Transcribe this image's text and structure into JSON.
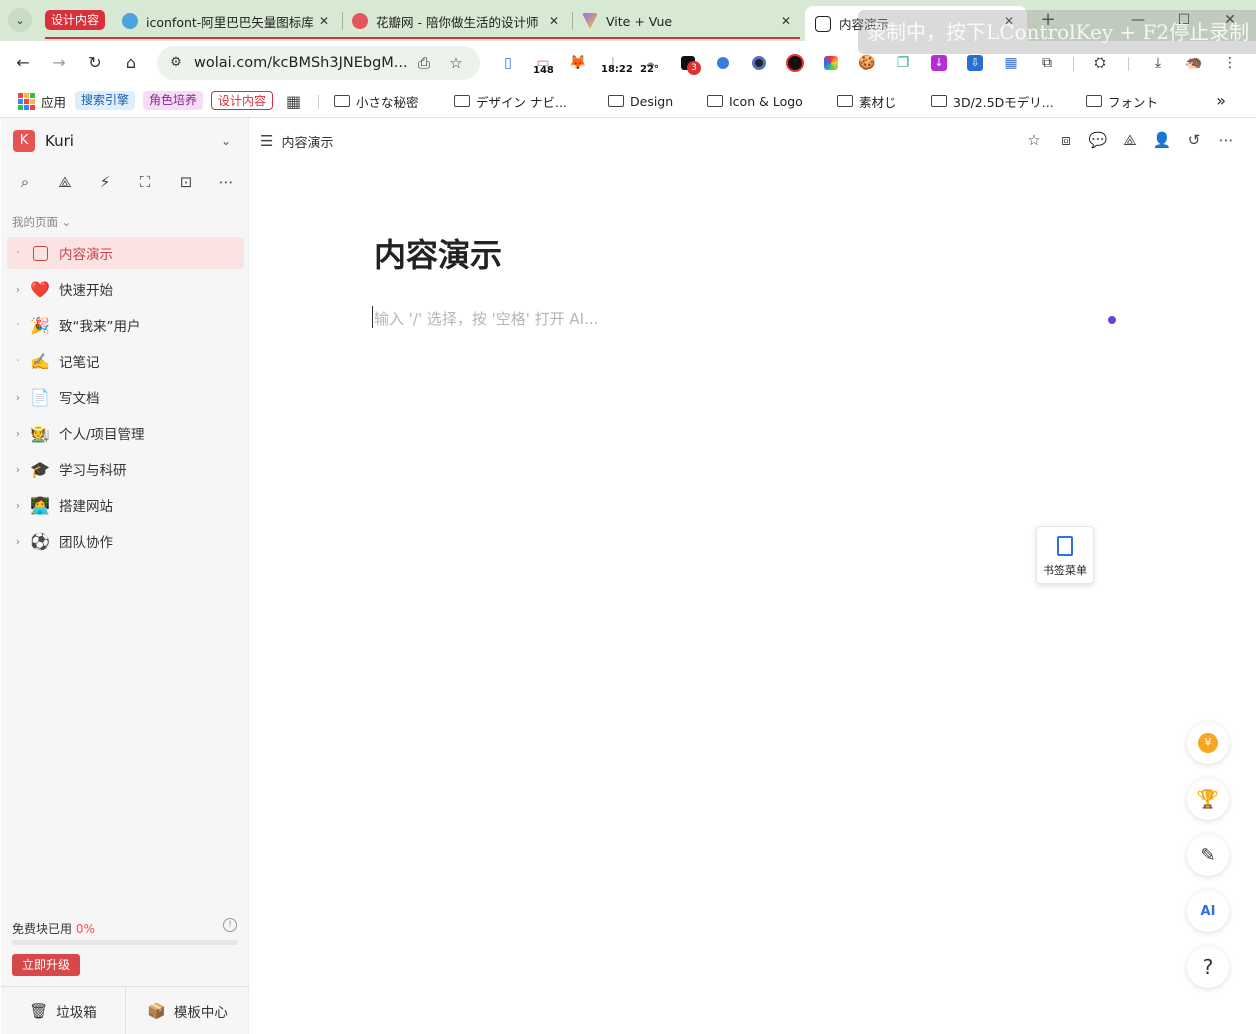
{
  "browser": {
    "tab_group_label": "设计内容",
    "tabs": [
      {
        "title": "iconfont-阿里巴巴矢量图标库",
        "close": "✕"
      },
      {
        "title": "花瓣网 - 陪你做生活的设计师",
        "close": "✕"
      },
      {
        "title": "Vite + Vue",
        "close": "✕"
      },
      {
        "title": "内容演示",
        "close": "✕"
      }
    ],
    "new_tab": "+",
    "recording_overlay": "录制中，按下LControlKey + F2停止录制",
    "url": "wolai.com/kcBMSh3JNEbgM...",
    "extension_badges": {
      "calendar": "148",
      "time": "18:22",
      "weather": "22°",
      "notify": "3"
    },
    "bookmarks": {
      "apps": "应用",
      "pills": [
        "搜索引擎",
        "角色培养",
        "设计内容"
      ],
      "folders": [
        "小さな秘密",
        "デザイン ナビ...",
        "Design",
        "Icon & Logo",
        "素材じ",
        "3D/2.5Dモデリ...",
        "フォント"
      ],
      "more": "»"
    }
  },
  "sidebar": {
    "workspace_initial": "K",
    "workspace_name": "Kuri",
    "section_label": "我的页面",
    "items": [
      {
        "label": "内容演示",
        "emoji": "",
        "expandable": false,
        "active": true
      },
      {
        "label": "快速开始",
        "emoji": "❤️",
        "expandable": true
      },
      {
        "label": "致“我来”用户",
        "emoji": "🎉",
        "expandable": false
      },
      {
        "label": "记笔记",
        "emoji": "✍️",
        "expandable": false
      },
      {
        "label": "写文档",
        "emoji": "📄",
        "expandable": true
      },
      {
        "label": "个人/项目管理",
        "emoji": "🧑‍🌾",
        "expandable": true
      },
      {
        "label": "学习与科研",
        "emoji": "🎓",
        "expandable": true
      },
      {
        "label": "搭建网站",
        "emoji": "👩‍💻",
        "expandable": true
      },
      {
        "label": "团队协作",
        "emoji": "⚽",
        "expandable": true
      }
    ],
    "usage_label": "免费块已用",
    "usage_percent": "0%",
    "usage_fraction": 0,
    "upgrade_label": "立即升级",
    "trash_label": "垃圾箱",
    "templates_label": "模板中心"
  },
  "main": {
    "breadcrumb": "内容演示",
    "page_title": "内容演示",
    "placeholder": "输入 '/' 选择，按 '空格' 打开 AI...",
    "bookmark_menu_label": "书签菜单",
    "help_label": "?"
  },
  "colors": {
    "accent": "#e55353",
    "tab_strip": "#d7e8d3",
    "active_nav_bg": "#fbe3e3",
    "purple_dot": "#6b3fd4"
  }
}
